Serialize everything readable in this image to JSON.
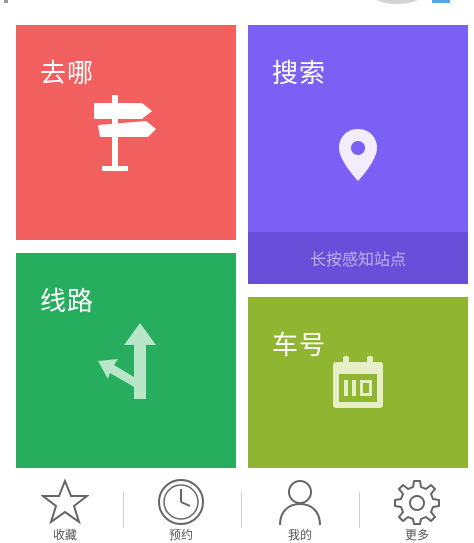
{
  "tiles": {
    "qu": {
      "title": "去哪",
      "color": "#f25f5f",
      "icon": "signpost-icon"
    },
    "sousuo": {
      "title": "搜索",
      "color": "#7b60f5",
      "icon": "location-pin-icon",
      "hint": "长按感知站点"
    },
    "xianlu": {
      "title": "线路",
      "color": "#26ad5d",
      "icon": "route-arrows-icon"
    },
    "chehao": {
      "title": "车号",
      "color": "#8fb531",
      "icon": "calendar-icon"
    }
  },
  "nav": [
    {
      "label": "收藏",
      "icon": "star-icon"
    },
    {
      "label": "预约",
      "icon": "clock-icon"
    },
    {
      "label": "我的",
      "icon": "user-icon"
    },
    {
      "label": "更多",
      "icon": "gear-icon"
    }
  ]
}
